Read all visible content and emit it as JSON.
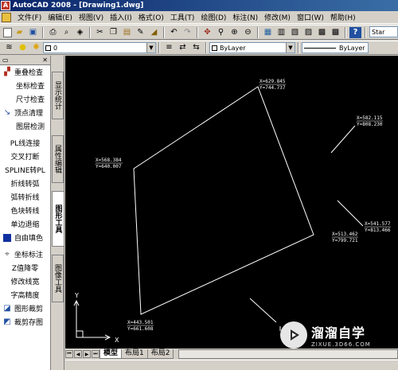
{
  "window": {
    "title": "AutoCAD 2008 - [Drawing1.dwg]",
    "app_icon": "autocad-logo-icon"
  },
  "menu": {
    "items": [
      "文件(F)",
      "编辑(E)",
      "视图(V)",
      "插入(I)",
      "格式(O)",
      "工具(T)",
      "绘图(D)",
      "标注(N)",
      "修改(M)",
      "窗口(W)",
      "帮助(H)"
    ]
  },
  "toolbar": {
    "text_style_value": "Star"
  },
  "layer_toolbar": {
    "layer_value": "0",
    "color_value": "ByLayer",
    "linetype_value": "ByLayer"
  },
  "left_panel": {
    "groups": [
      [
        {
          "label": "重叠检查",
          "icon": "overlap-check-icon"
        },
        {
          "label": "坐标检查",
          "icon": ""
        },
        {
          "label": "尺寸检查",
          "icon": ""
        },
        {
          "label": "顶点清理",
          "icon": "vertex-clean-icon"
        },
        {
          "label": "图层检测",
          "icon": ""
        }
      ],
      [
        {
          "label": "PL线连接",
          "icon": ""
        },
        {
          "label": "交叉打断",
          "icon": ""
        },
        {
          "label": "SPLINE转PL",
          "icon": ""
        },
        {
          "label": "折线转弧",
          "icon": ""
        },
        {
          "label": "弧转折线",
          "icon": ""
        },
        {
          "label": "色块转线",
          "icon": ""
        },
        {
          "label": "单边退缩",
          "icon": ""
        },
        {
          "label": "自由填色",
          "icon": "fill-color-icon"
        }
      ],
      [
        {
          "label": "坐标标注",
          "icon": "coordinate-label-icon"
        },
        {
          "label": "Z值降零",
          "icon": ""
        },
        {
          "label": "修改线宽",
          "icon": ""
        },
        {
          "label": "字高精度",
          "icon": ""
        },
        {
          "label": "图形裁剪",
          "icon": "clip-shape-icon"
        },
        {
          "label": "裁剪存图",
          "icon": "clip-save-icon"
        }
      ]
    ]
  },
  "vertical_tabs": [
    "显示统计",
    "属性编辑",
    "图形工具",
    "图像工具"
  ],
  "drawing": {
    "labels": [
      {
        "x": "X=629.845",
        "y": "Y=744.737"
      },
      {
        "x": "X=568.384",
        "y": "Y=640.007"
      },
      {
        "x": "X=582.115",
        "y": "Y=808.230"
      },
      {
        "x": "X=541.577",
        "y": "Y=813.466"
      },
      {
        "x": "X=513.462",
        "y": "Y=799.721"
      },
      {
        "x": "X=443.501",
        "y": "Y=661.608"
      }
    ],
    "ucs_x_label": "X",
    "ucs_y_label": "Y"
  },
  "bottom_tabs": {
    "tabs": [
      "模型",
      "布局1",
      "布局2"
    ],
    "active": "模型"
  },
  "watermark": {
    "title": "溜溜自学",
    "subtitle": "ZIXUE.3D66.COM"
  },
  "colors": {
    "drawing_bg": "#000000",
    "line": "#ffffff",
    "titlebar": "#0a246a"
  }
}
